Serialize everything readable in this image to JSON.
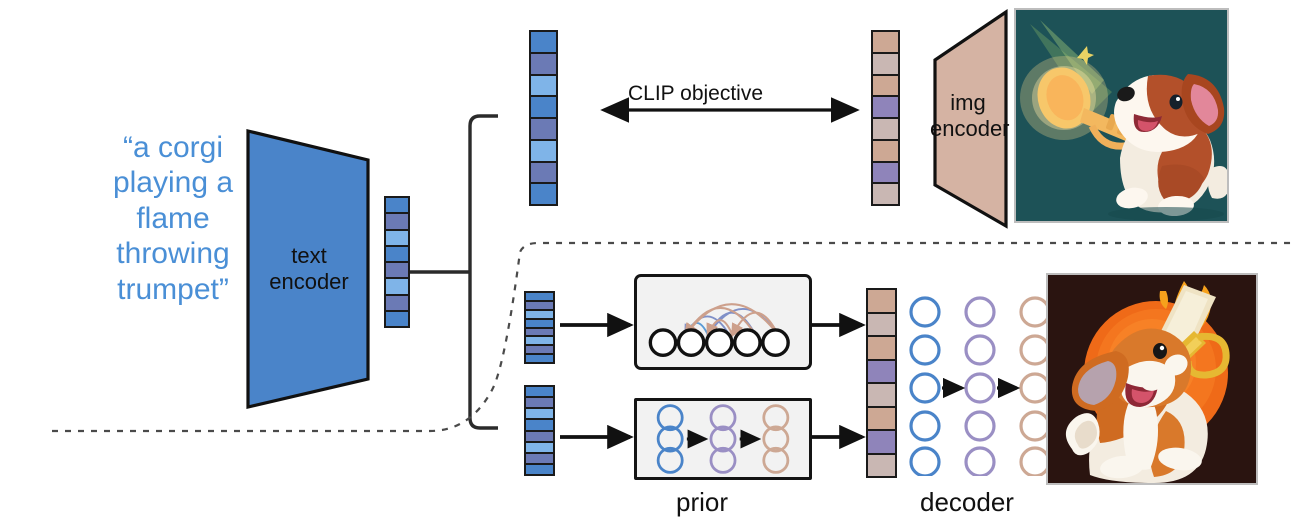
{
  "diagram": {
    "title": "unCLIP / DALL-E 2 architecture overview",
    "prompt": {
      "lines": [
        "“a corgi",
        "playing a",
        "flame",
        "throwing",
        "trumpet”"
      ],
      "color": "#4a8fd6"
    },
    "modules": {
      "text_encoder": {
        "label_line1": "text",
        "label_line2": "encoder",
        "fill": "#4a84c9",
        "stroke": "#111111"
      },
      "img_encoder": {
        "label_line1": "img",
        "label_line2": "encoder",
        "fill": "#d5b3a3",
        "stroke": "#111111"
      }
    },
    "clip_objective": {
      "label": "CLIP objective"
    },
    "captions": {
      "prior": "prior",
      "decoder": "decoder"
    },
    "embeddings": {
      "text_top": {
        "name": "text-embedding-top",
        "colors": [
          "#4a84c9",
          "#6b7ab5",
          "#7fb4e8",
          "#4a84c9",
          "#6b7ab5",
          "#7fb4e8",
          "#6b7ab5",
          "#4a84c9"
        ]
      },
      "text_mid": {
        "name": "text-embedding-middle",
        "colors": [
          "#4a84c9",
          "#6b7ab5",
          "#7fb4e8",
          "#4a84c9",
          "#6b7ab5",
          "#7fb4e8",
          "#6b7ab5",
          "#4a84c9"
        ]
      },
      "text_bottom": {
        "name": "text-embedding-bottom",
        "colors": [
          "#4a84c9",
          "#6b7ab5",
          "#7fb4e8",
          "#4a84c9",
          "#6b7ab5",
          "#7fb4e8",
          "#6b7ab5",
          "#4a84c9"
        ]
      },
      "text_small": {
        "name": "text-encoder-output-embedding",
        "colors": [
          "#4a84c9",
          "#6b7ab5",
          "#7fb4e8",
          "#4a84c9",
          "#6b7ab5",
          "#7fb4e8",
          "#6b7ab5",
          "#4a84c9"
        ]
      },
      "image_top": {
        "name": "image-embedding-clip",
        "colors": [
          "#cda894",
          "#c9b7b3",
          "#cda894",
          "#8f84ba",
          "#c9b7b3",
          "#cda894",
          "#8f84ba",
          "#c9b7b3"
        ]
      },
      "image_decoder": {
        "name": "image-embedding-decoder-input",
        "colors": [
          "#cda894",
          "#c9b7b3",
          "#cda894",
          "#8f84ba",
          "#c9b7b3",
          "#cda894",
          "#8f84ba",
          "#c9b7b3"
        ]
      }
    },
    "prior_autoregressive": {
      "name": "autoregressive-prior",
      "node_count": 5,
      "node_stroke": "#111111",
      "arc_colors": [
        "#cda08c",
        "#8090c8",
        "#cda08c",
        "#8090c8",
        "#cda08c"
      ]
    },
    "prior_diffusion": {
      "name": "diffusion-prior",
      "columns": 3,
      "rows": 3,
      "column_colors": [
        "#4a84c9",
        "#9a8fc4",
        "#cda894"
      ]
    },
    "decoder_network": {
      "name": "decoder-diffusion-network",
      "columns": 3,
      "rows": 5,
      "column_colors": [
        "#4a84c9",
        "#9a8fc4",
        "#cda894"
      ]
    },
    "images": {
      "clip_training_image": {
        "alt": "corgi playing a glowing trumpet, teal background",
        "background": "#1d5257",
        "accent": "#f7c76a"
      },
      "generated_image": {
        "alt": "corgi playing a flaming trombone, orange sun, dark background",
        "background": "#2a1410",
        "accent": "#ef6a18"
      }
    }
  }
}
